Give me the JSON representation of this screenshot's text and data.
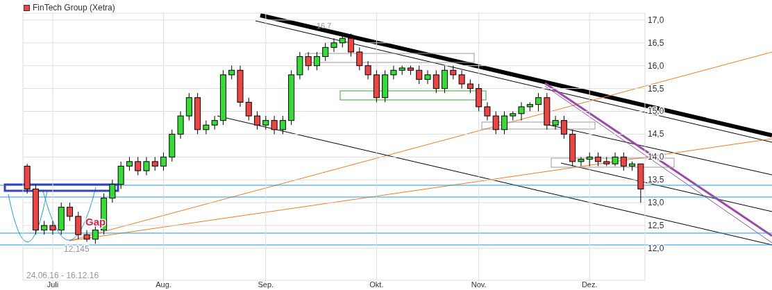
{
  "chart_data": {
    "type": "candlestick",
    "grid": true,
    "ylim": [
      11.3,
      17.15
    ],
    "yticks": [
      {
        "value": 12,
        "label": "12,0"
      },
      {
        "value": 12.5,
        "label": "12,5"
      },
      {
        "value": 13,
        "label": "13,0"
      },
      {
        "value": 13.5,
        "label": "13,5"
      },
      {
        "value": 14,
        "label": "14,0"
      },
      {
        "value": 14.5,
        "label": "14,5"
      },
      {
        "value": 15,
        "label": "15,0"
      },
      {
        "value": 15.5,
        "label": "15,5"
      },
      {
        "value": 16,
        "label": "16,0"
      },
      {
        "value": 16.5,
        "label": "16,5"
      },
      {
        "value": 17,
        "label": "17,0"
      }
    ],
    "categories": [
      null,
      null,
      null,
      "Juli",
      null,
      null,
      null,
      null,
      null,
      null,
      null,
      null,
      null,
      null,
      null,
      null,
      "Aug.",
      null,
      null,
      null,
      null,
      null,
      null,
      null,
      null,
      null,
      null,
      null,
      "Sep.",
      null,
      null,
      null,
      null,
      null,
      null,
      null,
      null,
      null,
      null,
      null,
      null,
      "Okt.",
      null,
      null,
      null,
      null,
      null,
      null,
      null,
      null,
      null,
      null,
      null,
      "Nov.",
      null,
      null,
      null,
      null,
      null,
      null,
      null,
      null,
      null,
      null,
      null,
      null,
      "Dez.",
      null,
      null,
      null,
      null,
      null,
      null
    ],
    "series": [
      {
        "name": "FinTech Group (Xetra)",
        "ohlc": [
          [
            13.8,
            13.85,
            13.2,
            13.3
          ],
          [
            13.3,
            13.4,
            12.3,
            12.4
          ],
          [
            12.4,
            12.6,
            12.3,
            12.5
          ],
          [
            12.5,
            12.6,
            12.3,
            12.4
          ],
          [
            12.4,
            13.0,
            12.3,
            12.9
          ],
          [
            12.9,
            13.0,
            12.6,
            12.7
          ],
          [
            12.7,
            12.8,
            12.2,
            12.3
          ],
          [
            12.3,
            12.4,
            12.145,
            12.2
          ],
          [
            12.2,
            12.5,
            12.1,
            12.4
          ],
          [
            12.4,
            13.2,
            12.3,
            13.1
          ],
          [
            13.1,
            13.5,
            13.0,
            13.4
          ],
          [
            13.4,
            13.9,
            13.3,
            13.8
          ],
          [
            13.8,
            14.0,
            13.7,
            13.9
          ],
          [
            13.9,
            14.0,
            13.6,
            13.7
          ],
          [
            13.7,
            14.0,
            13.6,
            13.9
          ],
          [
            13.9,
            14.0,
            13.7,
            13.8
          ],
          [
            13.8,
            14.1,
            13.7,
            14.0
          ],
          [
            14.0,
            14.6,
            13.9,
            14.5
          ],
          [
            14.5,
            15.0,
            14.4,
            14.9
          ],
          [
            14.9,
            15.4,
            14.8,
            15.3
          ],
          [
            15.3,
            15.4,
            14.5,
            14.6
          ],
          [
            14.6,
            14.8,
            14.5,
            14.7
          ],
          [
            14.7,
            14.9,
            14.6,
            14.8
          ],
          [
            14.8,
            15.9,
            14.7,
            15.8
          ],
          [
            15.8,
            16.0,
            15.7,
            15.9
          ],
          [
            15.9,
            16.0,
            15.1,
            15.2
          ],
          [
            15.2,
            15.3,
            14.8,
            14.9
          ],
          [
            14.9,
            15.0,
            14.6,
            14.7
          ],
          [
            14.7,
            14.9,
            14.6,
            14.8
          ],
          [
            14.8,
            14.9,
            14.5,
            14.6
          ],
          [
            14.6,
            14.9,
            14.5,
            14.8
          ],
          [
            14.8,
            15.9,
            14.7,
            15.8
          ],
          [
            15.8,
            16.3,
            15.7,
            16.2
          ],
          [
            16.2,
            16.3,
            15.9,
            16.0
          ],
          [
            16.0,
            16.3,
            15.9,
            16.2
          ],
          [
            16.2,
            16.5,
            16.1,
            16.4
          ],
          [
            16.4,
            16.6,
            16.3,
            16.5
          ],
          [
            16.5,
            16.7,
            16.4,
            16.6
          ],
          [
            16.6,
            16.7,
            16.2,
            16.3
          ],
          [
            16.3,
            16.4,
            15.9,
            16.0
          ],
          [
            16.0,
            16.1,
            15.7,
            15.8
          ],
          [
            15.8,
            15.9,
            15.2,
            15.3
          ],
          [
            15.3,
            15.9,
            15.2,
            15.8
          ],
          [
            15.8,
            16.0,
            15.7,
            15.9
          ],
          [
            15.9,
            16.0,
            15.8,
            15.95
          ],
          [
            15.95,
            16.0,
            15.8,
            15.9
          ],
          [
            15.9,
            16.0,
            15.6,
            15.7
          ],
          [
            15.7,
            15.9,
            15.6,
            15.8
          ],
          [
            15.8,
            15.9,
            15.4,
            15.5
          ],
          [
            15.5,
            16.0,
            15.4,
            15.9
          ],
          [
            15.9,
            16.0,
            15.7,
            15.8
          ],
          [
            15.8,
            15.9,
            15.5,
            15.6
          ],
          [
            15.6,
            15.7,
            15.4,
            15.5
          ],
          [
            15.5,
            15.6,
            15.0,
            15.1
          ],
          [
            15.1,
            15.2,
            14.8,
            14.9
          ],
          [
            14.9,
            15.0,
            14.5,
            14.6
          ],
          [
            14.6,
            15.0,
            14.5,
            14.9
          ],
          [
            14.9,
            15.0,
            14.8,
            14.95
          ],
          [
            14.95,
            15.2,
            14.8,
            15.1
          ],
          [
            15.1,
            15.2,
            15.0,
            15.15
          ],
          [
            15.15,
            15.4,
            15.0,
            15.3
          ],
          [
            15.3,
            15.4,
            14.6,
            14.7
          ],
          [
            14.7,
            14.9,
            14.6,
            14.8
          ],
          [
            14.8,
            14.9,
            14.4,
            14.5
          ],
          [
            14.5,
            14.6,
            13.8,
            13.9
          ],
          [
            13.9,
            14.0,
            13.8,
            13.95
          ],
          [
            13.95,
            14.1,
            13.8,
            14.0
          ],
          [
            14.0,
            14.1,
            13.8,
            13.9
          ],
          [
            13.9,
            14.0,
            13.8,
            13.85
          ],
          [
            13.85,
            14.1,
            13.8,
            14.0
          ],
          [
            14.0,
            14.1,
            13.7,
            13.8
          ],
          [
            13.8,
            13.9,
            13.7,
            13.85
          ],
          [
            13.85,
            13.85,
            13.0,
            13.3
          ]
        ]
      }
    ],
    "annotations": [
      {
        "text": "16,7"
      },
      {
        "text": "12,145"
      },
      {
        "text": "Gap"
      },
      {
        "text": "24.06.16 - 16.12.16"
      }
    ]
  }
}
